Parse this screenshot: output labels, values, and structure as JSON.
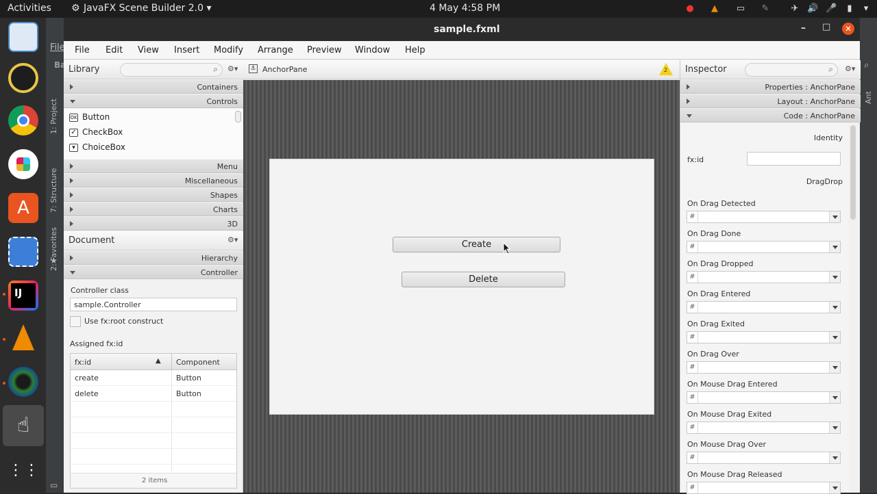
{
  "topbar": {
    "activities": "Activities",
    "app_menu": "JavaFX Scene Builder 2.0 ▾",
    "clock": "4 May  4:58 PM"
  },
  "ide_strip": {
    "file_label": "File",
    "ba_label": "Ba",
    "project_tab": "1: Project",
    "structure_tab": "7: Structure",
    "favorites_tab": "2: Favorites",
    "right_tab": "Ant"
  },
  "window": {
    "title": "sample.fxml",
    "menus": [
      "File",
      "Edit",
      "View",
      "Insert",
      "Modify",
      "Arrange",
      "Preview",
      "Window",
      "Help"
    ]
  },
  "library": {
    "title": "Library",
    "sections": {
      "containers": "Containers",
      "controls": "Controls",
      "menu": "Menu",
      "misc": "Miscellaneous",
      "shapes": "Shapes",
      "charts": "Charts",
      "threed": "3D"
    },
    "items": [
      {
        "label": "Button",
        "icon": "OK"
      },
      {
        "label": "CheckBox",
        "icon": "✓"
      },
      {
        "label": "ChoiceBox",
        "icon": "▾"
      }
    ]
  },
  "document": {
    "title": "Document",
    "hierarchy": "Hierarchy",
    "controller": "Controller",
    "controller_class_label": "Controller class",
    "controller_class_value": "sample.Controller",
    "root_construct_label": "Use fx:root construct",
    "assigned_label": "Assigned fx:id",
    "table": {
      "col1": "fx:id",
      "col2": "Component",
      "rows": [
        {
          "fxid": "create",
          "component": "Button"
        },
        {
          "fxid": "delete",
          "component": "Button"
        }
      ],
      "footer": "2 items"
    }
  },
  "content": {
    "breadcrumb": "AnchorPane",
    "warning_count": "2",
    "create_button": "Create",
    "delete_button": "Delete"
  },
  "inspector": {
    "title": "Inspector",
    "sections": {
      "properties": "Properties : AnchorPane",
      "layout": "Layout : AnchorPane",
      "code": "Code : AnchorPane"
    },
    "identity_header": "Identity",
    "fxid_label": "fx:id",
    "dragdrop_header": "DragDrop",
    "hash": "#",
    "events": [
      "On Drag Detected",
      "On Drag Done",
      "On Drag Dropped",
      "On Drag Entered",
      "On Drag Exited",
      "On Drag Over",
      "On Mouse Drag Entered",
      "On Mouse Drag Exited",
      "On Mouse Drag Over",
      "On Mouse Drag Released"
    ]
  },
  "colors": {
    "accent_close": "#e95420",
    "warning": "#f3d11b"
  }
}
